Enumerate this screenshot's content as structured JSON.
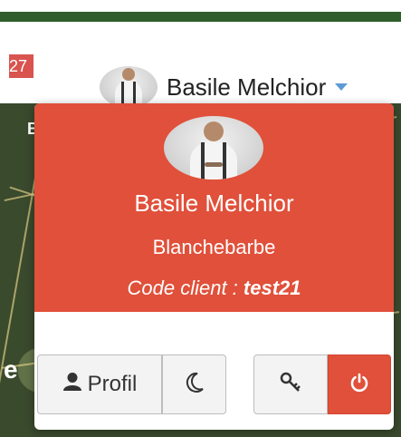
{
  "header": {
    "badge_count": "27",
    "user_name": "Basile Melchior"
  },
  "map": {
    "letter_top": "B",
    "letter_mid": "e"
  },
  "dropdown": {
    "name": "Basile Melchior",
    "company": "Blanchebarbe",
    "code_prefix": "Code client : ",
    "code_value": "test21",
    "buttons": {
      "profile_label": "Profil"
    }
  },
  "colors": {
    "accent": "#e0503a",
    "green_bar": "#2f5e2c",
    "caret": "#5b9bd5"
  },
  "icons": [
    "user-icon",
    "moon-icon",
    "key-icon",
    "power-icon",
    "chevron-down-icon"
  ]
}
